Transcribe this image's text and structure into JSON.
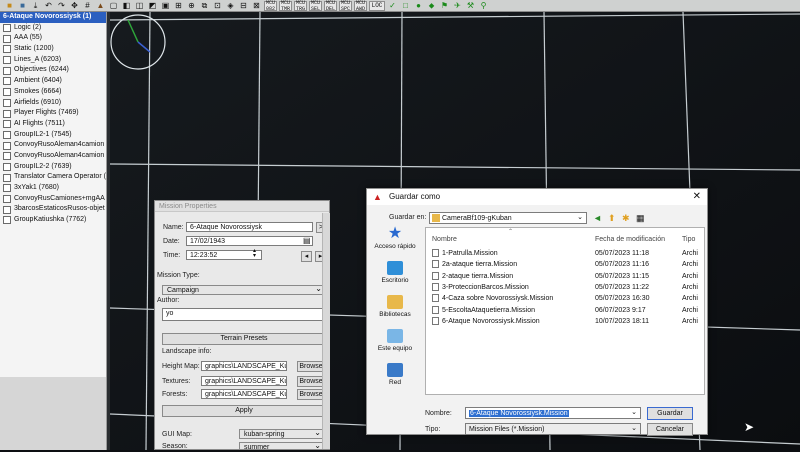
{
  "toolbar": {
    "buttons": [
      "Logic",
      "Static",
      "Light",
      "Objects",
      "Vehicles",
      "Select",
      "Hide",
      "Lock",
      "Unlock",
      "Cam",
      "Mission",
      "Save",
      "Open",
      "Copy",
      "Paste",
      "Del",
      "Undo",
      "Redo",
      "Zoom",
      "Grid",
      "MCU",
      "MCU",
      "MCU",
      "MCU",
      "MCU",
      "MCU",
      "MCU",
      "LOC"
    ],
    "labels": [
      "MCU 082",
      "MCU TMR",
      "MCU TRG",
      "MCU SEL",
      "MCU DEL",
      "MCU SPC",
      "MCU AWD",
      "LOC"
    ]
  },
  "tree": {
    "items": [
      "6-Ataque Novorossiysk (1)",
      "Logic (2)",
      "AAA (55)",
      "Static (1200)",
      "Lines_A (6203)",
      "Objectives (6244)",
      "Ambient (6404)",
      "Smokes (6664)",
      "Airfields (6910)",
      "Player Flights (7469)",
      "AI Flights (7511)",
      "GroupIL2-1 (7545)",
      "ConvoyRusoAleman4camion",
      "ConvoyRusoAleman4camion",
      "GroupIL2-2 (7639)",
      "Translator Camera Operator (",
      "3xYak1 (7680)",
      "ConvoyRusCamiones+mgAA",
      "3barcosEstaticosRusos-objet",
      "GroupKatiushka (7762)"
    ]
  },
  "mission_props": {
    "title": "Mission Properties",
    "name_label": "Name:",
    "name_value": "6-Ataque Novorossiysk",
    "date_label": "Date:",
    "date_value": "17/02/1943",
    "time_label": "Time:",
    "time_value": "12:23:52",
    "type_label": "Mission Type:",
    "type_value": "Campaign",
    "author_label": "Author:",
    "author_value": "yo",
    "terrain_presets": "Terrain Presets",
    "landscape_label": "Landscape info:",
    "heightmap_label": "Height Map:",
    "heightmap_value": "graphics\\LANDSCAPE_Kuba",
    "textures_label": "Textures:",
    "textures_value": "graphics\\LANDSCAPE_Kuba",
    "forests_label": "Forests:",
    "forests_value": "graphics\\LANDSCAPE_Kuba",
    "browse": "Browse",
    "apply": "Apply",
    "gui_label": "GUI Map:",
    "gui_value": "kuban-spring",
    "season_label": "Season:",
    "season_value": "summer"
  },
  "dialog": {
    "title": "Guardar como",
    "save_in_label": "Guardar en:",
    "save_in_value": "CameraBf109-gKuban",
    "places": [
      "Acceso rápido",
      "Escritorio",
      "Bibliotecas",
      "Este equipo",
      "Red"
    ],
    "col_name": "Nombre",
    "col_date": "Fecha de modificación",
    "col_type": "Tipo",
    "files": [
      {
        "name": "1-Patrulla.Mission",
        "date": "05/07/2023 11:18",
        "type": "Archi"
      },
      {
        "name": "2a-ataque tierra.Mission",
        "date": "05/07/2023 11:16",
        "type": "Archi"
      },
      {
        "name": "2-ataque tierra.Mission",
        "date": "05/07/2023 11:15",
        "type": "Archi"
      },
      {
        "name": "3-ProteccionBarcos.Mission",
        "date": "05/07/2023 11:22",
        "type": "Archi"
      },
      {
        "name": "4-Caza sobre Novorossiysk.Mission",
        "date": "05/07/2023 16:30",
        "type": "Archi"
      },
      {
        "name": "5-EscoltaAtaquetierra.Mission",
        "date": "06/07/2023 9:17",
        "type": "Archi"
      },
      {
        "name": "6-Ataque Novorossiysk.Mission",
        "date": "10/07/2023 18:11",
        "type": "Archi"
      }
    ],
    "filename_label": "Nombre:",
    "filename_value": "6-Ataque Novorossiysk.Mission",
    "filetype_label": "Tipo:",
    "filetype_value": "Mission Files (*.Mission)",
    "save_button": "Guardar",
    "cancel_button": "Cancelar"
  }
}
